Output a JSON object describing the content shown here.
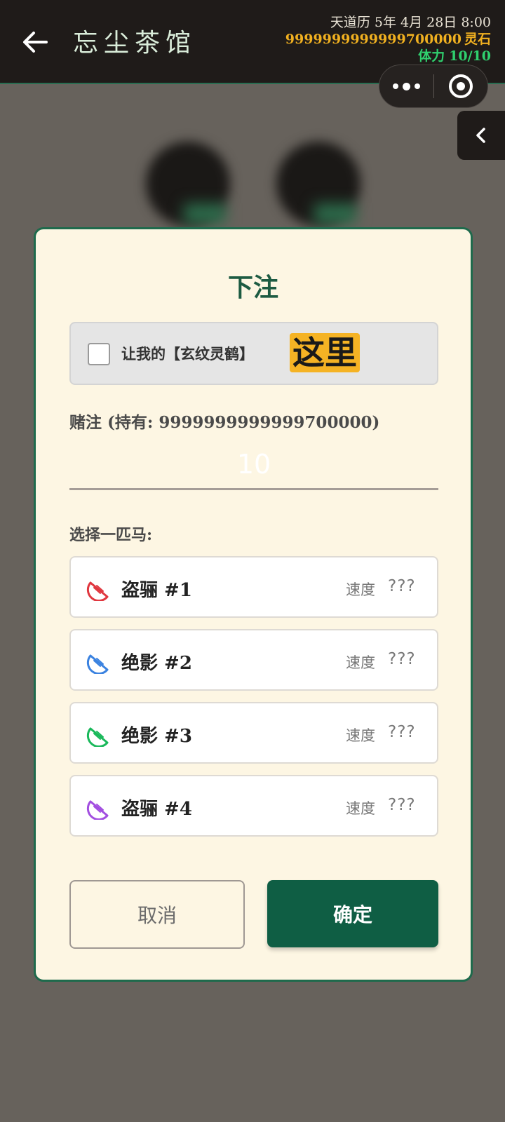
{
  "header": {
    "title": "忘尘茶馆",
    "date": "天道历 5年 4月 28日 8:00",
    "money": "9999999999999700000",
    "money_unit": "灵石",
    "stamina_label": "体力",
    "stamina_value": "10/10"
  },
  "modal": {
    "title": "下注",
    "option_label": "让我的【玄纹灵鹤】",
    "highlight_text": "这里",
    "bet_label": "赌注 (持有: 9999999999999700000)",
    "bet_placeholder": "10",
    "horse_label": "选择一匹马:",
    "horses": [
      {
        "name": "盗骊 #1",
        "speed_label": "速度",
        "speed_value": "???",
        "icon_color": "#e0363e"
      },
      {
        "name": "绝影 #2",
        "speed_label": "速度",
        "speed_value": "???",
        "icon_color": "#3a82e0"
      },
      {
        "name": "绝影 #3",
        "speed_label": "速度",
        "speed_value": "???",
        "icon_color": "#19b85a"
      },
      {
        "name": "盗骊 #4",
        "speed_label": "速度",
        "speed_value": "???",
        "icon_color": "#a24ee0"
      }
    ],
    "cancel_label": "取消",
    "confirm_label": "确定"
  },
  "colors": {
    "accent_green": "#0f5e44",
    "money_gold": "#f0b020",
    "stamina_green": "#2fd06e"
  }
}
